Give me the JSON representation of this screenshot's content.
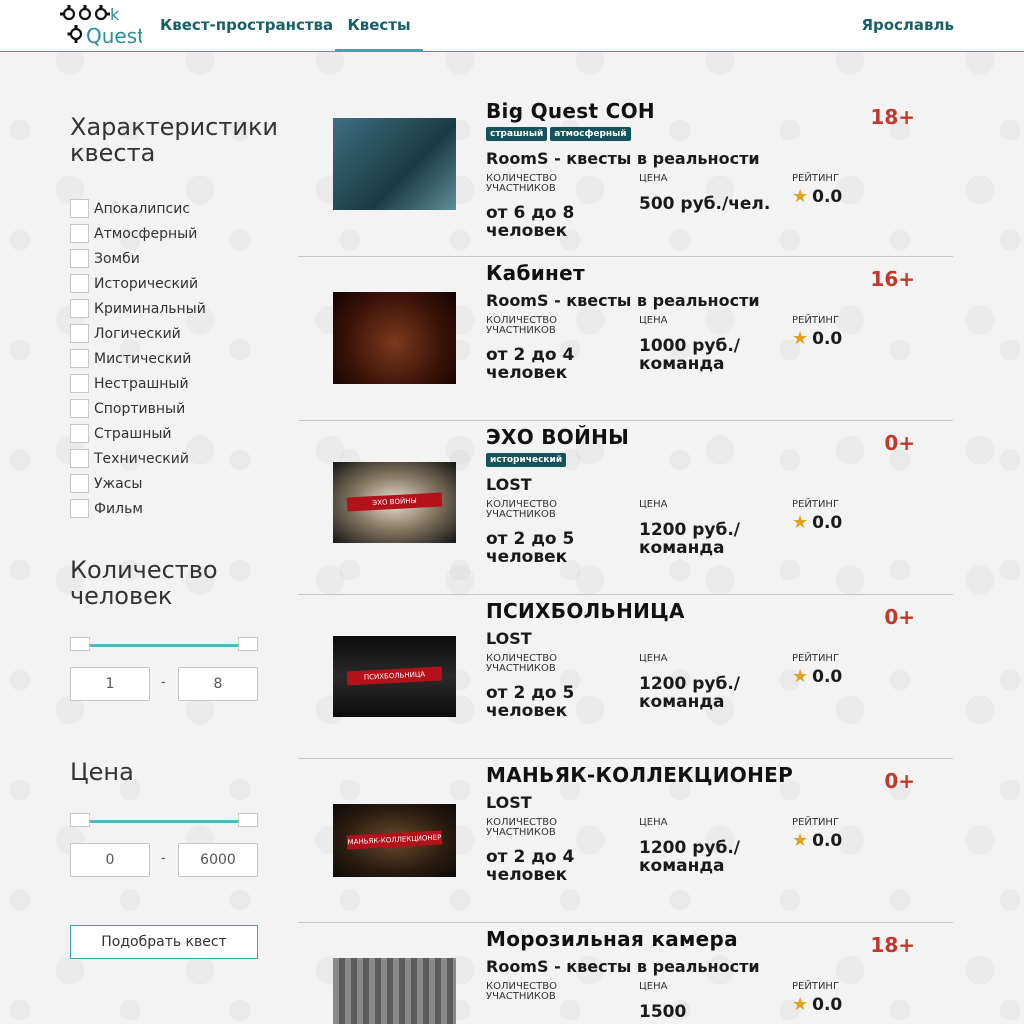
{
  "header": {
    "logo_text": "BookQuest",
    "nav": [
      {
        "label": "Квест-пространства"
      },
      {
        "label": "Квесты"
      }
    ],
    "city": "Ярославль"
  },
  "sidebar": {
    "characteristics_title": "Характеристики квеста",
    "filters": [
      "Апокалипсис",
      "Атмосферный",
      "Зомби",
      "Исторический",
      "Криминальный",
      "Логический",
      "Мистический",
      "Нестрашный",
      "Спортивный",
      "Страшный",
      "Технический",
      "Ужасы",
      "Фильм"
    ],
    "people_title": "Количество человек",
    "people_min": "1",
    "people_max": "8",
    "price_title": "Цена",
    "price_min": "0",
    "price_max": "6000",
    "range_separator": "-",
    "submit_label": "Подобрать квест"
  },
  "labels": {
    "participants": "КОЛИЧЕСТВО УЧАСТНИКОВ",
    "price": "ЦЕНА",
    "rating": "РЕЙТИНГ"
  },
  "quests": [
    {
      "title": "Big Quest СОН",
      "age": "18+",
      "tags": [
        "страшный",
        "атмосферный"
      ],
      "company": "RoomS - квесты в реальности",
      "participants": "от 6 до 8 человек",
      "price": "500 руб./чел.",
      "rating": "0.0"
    },
    {
      "title": "Кабинет",
      "age": "16+",
      "tags": [],
      "company": "RoomS - квесты в реальности",
      "participants": "от 2 до 4 человек",
      "price": "1000 руб./команда",
      "rating": "0.0"
    },
    {
      "title": "ЭХО ВОЙНЫ",
      "age": "0+",
      "tags": [
        "исторический"
      ],
      "company": "LOST",
      "participants": "от 2 до 5 человек",
      "price": "1200 руб./команда",
      "rating": "0.0",
      "thumb_text": "ЭХО ВОЙНЫ"
    },
    {
      "title": "ПСИХБОЛЬНИЦА",
      "age": "0+",
      "tags": [],
      "company": "LOST",
      "participants": "от 2 до 5 человек",
      "price": "1200 руб./команда",
      "rating": "0.0",
      "thumb_text": "ПСИХБОЛЬНИЦА"
    },
    {
      "title": "МАНЬЯК-КОЛЛЕКЦИОНЕР",
      "age": "0+",
      "tags": [],
      "company": "LOST",
      "participants": "от 2 до 4 человек",
      "price": "1200 руб./команда",
      "rating": "0.0",
      "thumb_text": "МАНЬЯК-КОЛЛЕКЦИОНЕР"
    },
    {
      "title": "Морозильная камера",
      "age": "18+",
      "tags": [],
      "company": "RoomS - квесты в реальности",
      "participants": "",
      "price": "1500",
      "rating": "0.0"
    }
  ],
  "colors": {
    "accent": "#3aa7b0",
    "nav_text": "#1b5f66",
    "tag_bg": "#14535a",
    "age_red": "#c0392b",
    "star": "#e0a21b"
  },
  "icons": {
    "star": "star-icon",
    "logo": "gears-logo"
  }
}
